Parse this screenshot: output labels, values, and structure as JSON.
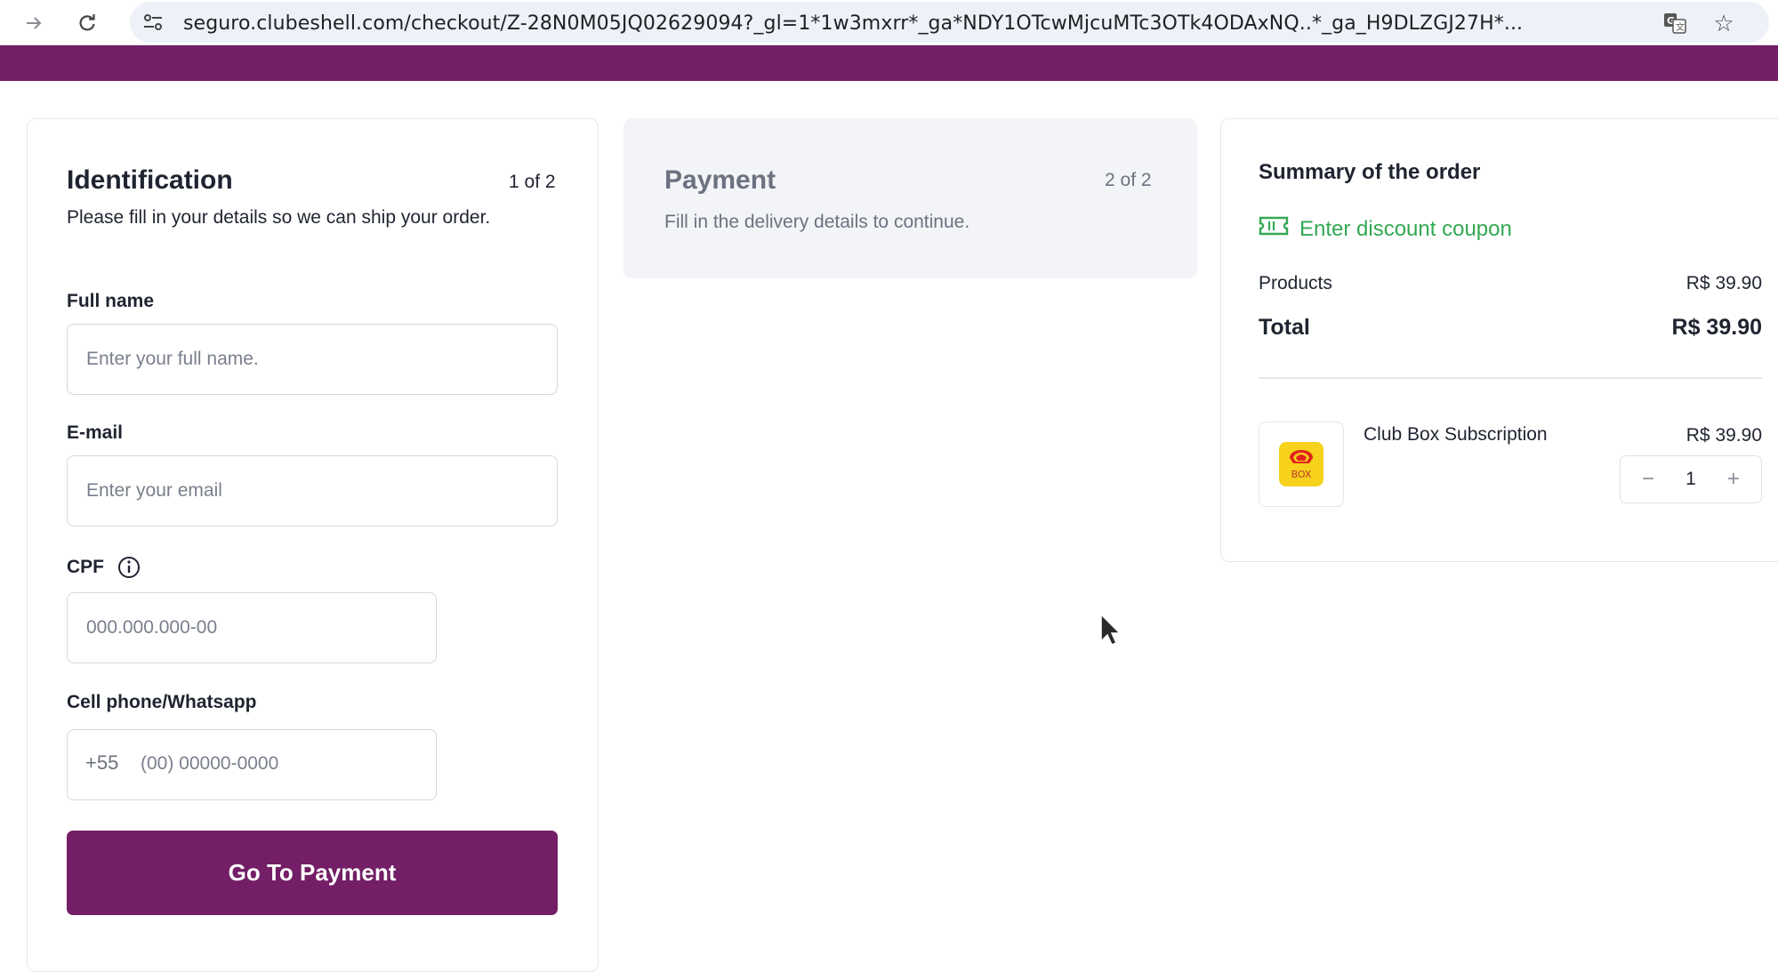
{
  "browser": {
    "url": "seguro.clubeshell.com/checkout/Z-28N0M05JQ02629094?_gl=1*1w3mxrr*_ga*NDY1OTcwMjcuMTc3OTk4ODAxNQ..*_ga_H9DLZGJ27H*..."
  },
  "identification": {
    "title": "Identification",
    "step": "1 of 2",
    "description": "Please fill in your details so we can ship your order.",
    "full_name_label": "Full name",
    "full_name_placeholder": "Enter your full name.",
    "email_label": "E-mail",
    "email_placeholder": "Enter your email",
    "cpf_label": "CPF",
    "cpf_placeholder": "000.000.000-00",
    "phone_label": "Cell phone/Whatsapp",
    "phone_prefix": "+55",
    "phone_placeholder": "(00) 00000-0000",
    "submit_label": "Go To Payment"
  },
  "payment": {
    "title": "Payment",
    "step": "2 of 2",
    "description": "Fill in the delivery details to continue."
  },
  "summary": {
    "title": "Summary of the order",
    "coupon_label": "Enter discount coupon",
    "products_label": "Products",
    "products_value": "R$ 39.90",
    "total_label": "Total",
    "total_value": "R$ 39.90",
    "item_name": "Club Box Subscription",
    "item_price": "R$ 39.90",
    "item_quantity": "1",
    "item_badge": "BOX"
  },
  "colors": {
    "brand": "#731e66",
    "coupon": "#34a853"
  }
}
